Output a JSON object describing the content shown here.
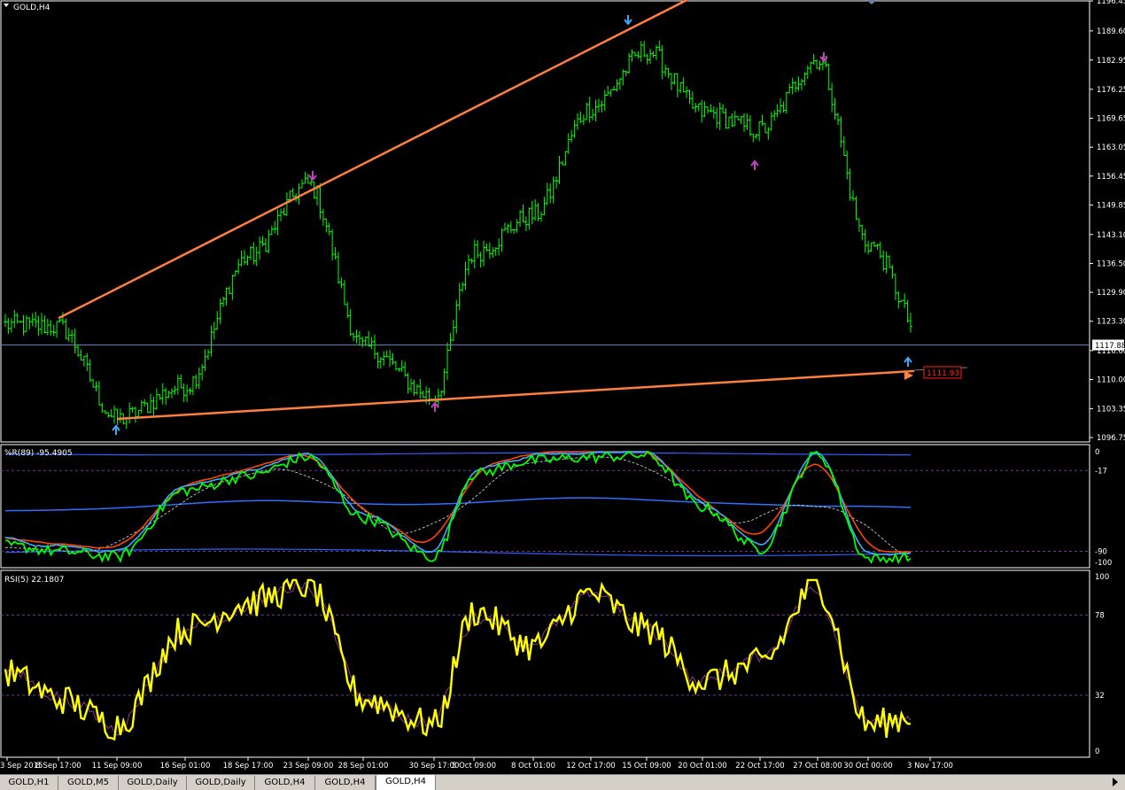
{
  "main": {
    "title": "GOLD,H4",
    "price_labels": [
      "1196.45",
      "1189.60",
      "1182.95",
      "1176.25",
      "1169.65",
      "1163.05",
      "1156.45",
      "1149.85",
      "1143.10",
      "1136.50",
      "1129.90",
      "1123.30",
      "1116.60",
      "1110.00",
      "1103.35",
      "1096.75"
    ],
    "current_price": "1117.88",
    "target_label": "1111.93"
  },
  "wr_panel": {
    "title": "%R(89) -95.4905",
    "levels": [
      "0",
      "-17",
      "-90",
      "-100"
    ]
  },
  "rsi_panel": {
    "title": "RSI(5) 22.1807",
    "levels": [
      "100",
      "78",
      "32",
      "0"
    ]
  },
  "x_labels": [
    "3 Sep 2015",
    "8 Sep 17:00",
    "11 Sep 09:00",
    "16 Sep 01:00",
    "18 Sep 17:00",
    "23 Sep 09:00",
    "28 Sep 01:00",
    "30 Sep 17:00",
    "5 Oct 09:00",
    "8 Oct 01:00",
    "12 Oct 17:00",
    "15 Oct 09:00",
    "20 Oct 01:00",
    "22 Oct 17:00",
    "27 Oct 08:00",
    "30 Oct 00:00",
    "3 Nov 17:00"
  ],
  "tabs": [
    "GOLD,H1",
    "GOLD,M5",
    "GOLD,Daily",
    "GOLD,Daily",
    "GOLD,H4",
    "GOLD,H4",
    "GOLD,H4"
  ],
  "colors": {
    "candle": "#00ff00",
    "trendline": "#ff7f3f",
    "rsi": "#ffff00",
    "rsi_signal": "#8b3a8b",
    "wr_fast": "#00ff00",
    "wr_mid": "#3fa9f5",
    "wr_slow": "#ff4500",
    "wr_band": "#3060ff",
    "price_line": "#5f7fbf"
  },
  "chart_data": [
    {
      "type": "line",
      "name": "GOLD,H4 price",
      "x": [
        "3 Sep 2015",
        "8 Sep 17:00",
        "11 Sep 09:00",
        "16 Sep 01:00",
        "18 Sep 17:00",
        "23 Sep 09:00",
        "28 Sep 01:00",
        "30 Sep 17:00",
        "5 Oct 09:00",
        "8 Oct 01:00",
        "12 Oct 17:00",
        "15 Oct 09:00",
        "20 Oct 01:00",
        "22 Oct 17:00",
        "27 Oct 08:00",
        "30 Oct 00:00",
        "3 Nov 17:00"
      ],
      "series": [
        {
          "values": [
            1122.5,
            1122.0,
            1101.0,
            1108.5,
            1138.0,
            1154.5,
            1117.5,
            1106.0,
            1139.0,
            1147.5,
            1172.0,
            1185.0,
            1171.0,
            1167.0,
            1183.0,
            1141.0,
            1116.5
          ]
        }
      ],
      "ylim": [
        1096.75,
        1196.45
      ],
      "current_price": 1117.88,
      "trendlines": [
        {
          "from": [
            "8 Sep 17:00",
            1124.0
          ],
          "to": [
            "15 Oct 09:00",
            1192.0
          ]
        },
        {
          "from": [
            "11 Sep 09:00",
            1101.0
          ],
          "to": [
            "3 Nov 17:00",
            1111.93
          ]
        }
      ]
    },
    {
      "type": "line",
      "name": "%R(89)",
      "x": [
        "3 Sep 2015",
        "8 Sep 17:00",
        "11 Sep 09:00",
        "16 Sep 01:00",
        "18 Sep 17:00",
        "23 Sep 09:00",
        "28 Sep 01:00",
        "30 Sep 17:00",
        "5 Oct 09:00",
        "8 Oct 01:00",
        "12 Oct 17:00",
        "15 Oct 09:00",
        "20 Oct 01:00",
        "22 Oct 17:00",
        "27 Oct 08:00",
        "30 Oct 00:00",
        "3 Nov 17:00"
      ],
      "series": [
        {
          "values": [
            -85,
            -90,
            -95,
            -35,
            -22,
            -5,
            -60,
            -95,
            -20,
            -8,
            -5,
            -3,
            -50,
            -88,
            -2,
            -97,
            -95.4905
          ]
        }
      ],
      "ylim": [
        -100,
        0
      ],
      "levels": [
        0,
        -17,
        -90,
        -100
      ]
    },
    {
      "type": "line",
      "name": "RSI(5)",
      "x": [
        "3 Sep 2015",
        "8 Sep 17:00",
        "11 Sep 09:00",
        "16 Sep 01:00",
        "18 Sep 17:00",
        "23 Sep 09:00",
        "28 Sep 01:00",
        "30 Sep 17:00",
        "5 Oct 09:00",
        "8 Oct 01:00",
        "12 Oct 17:00",
        "15 Oct 09:00",
        "20 Oct 01:00",
        "22 Oct 17:00",
        "27 Oct 08:00",
        "30 Oct 00:00",
        "3 Nov 17:00"
      ],
      "series": [
        {
          "values": [
            45,
            30,
            15,
            70,
            85,
            95,
            30,
            15,
            80,
            60,
            90,
            70,
            40,
            50,
            95,
            15,
            22.1807
          ]
        }
      ],
      "ylim": [
        0,
        100
      ],
      "levels": [
        100,
        78,
        32,
        0
      ]
    }
  ]
}
